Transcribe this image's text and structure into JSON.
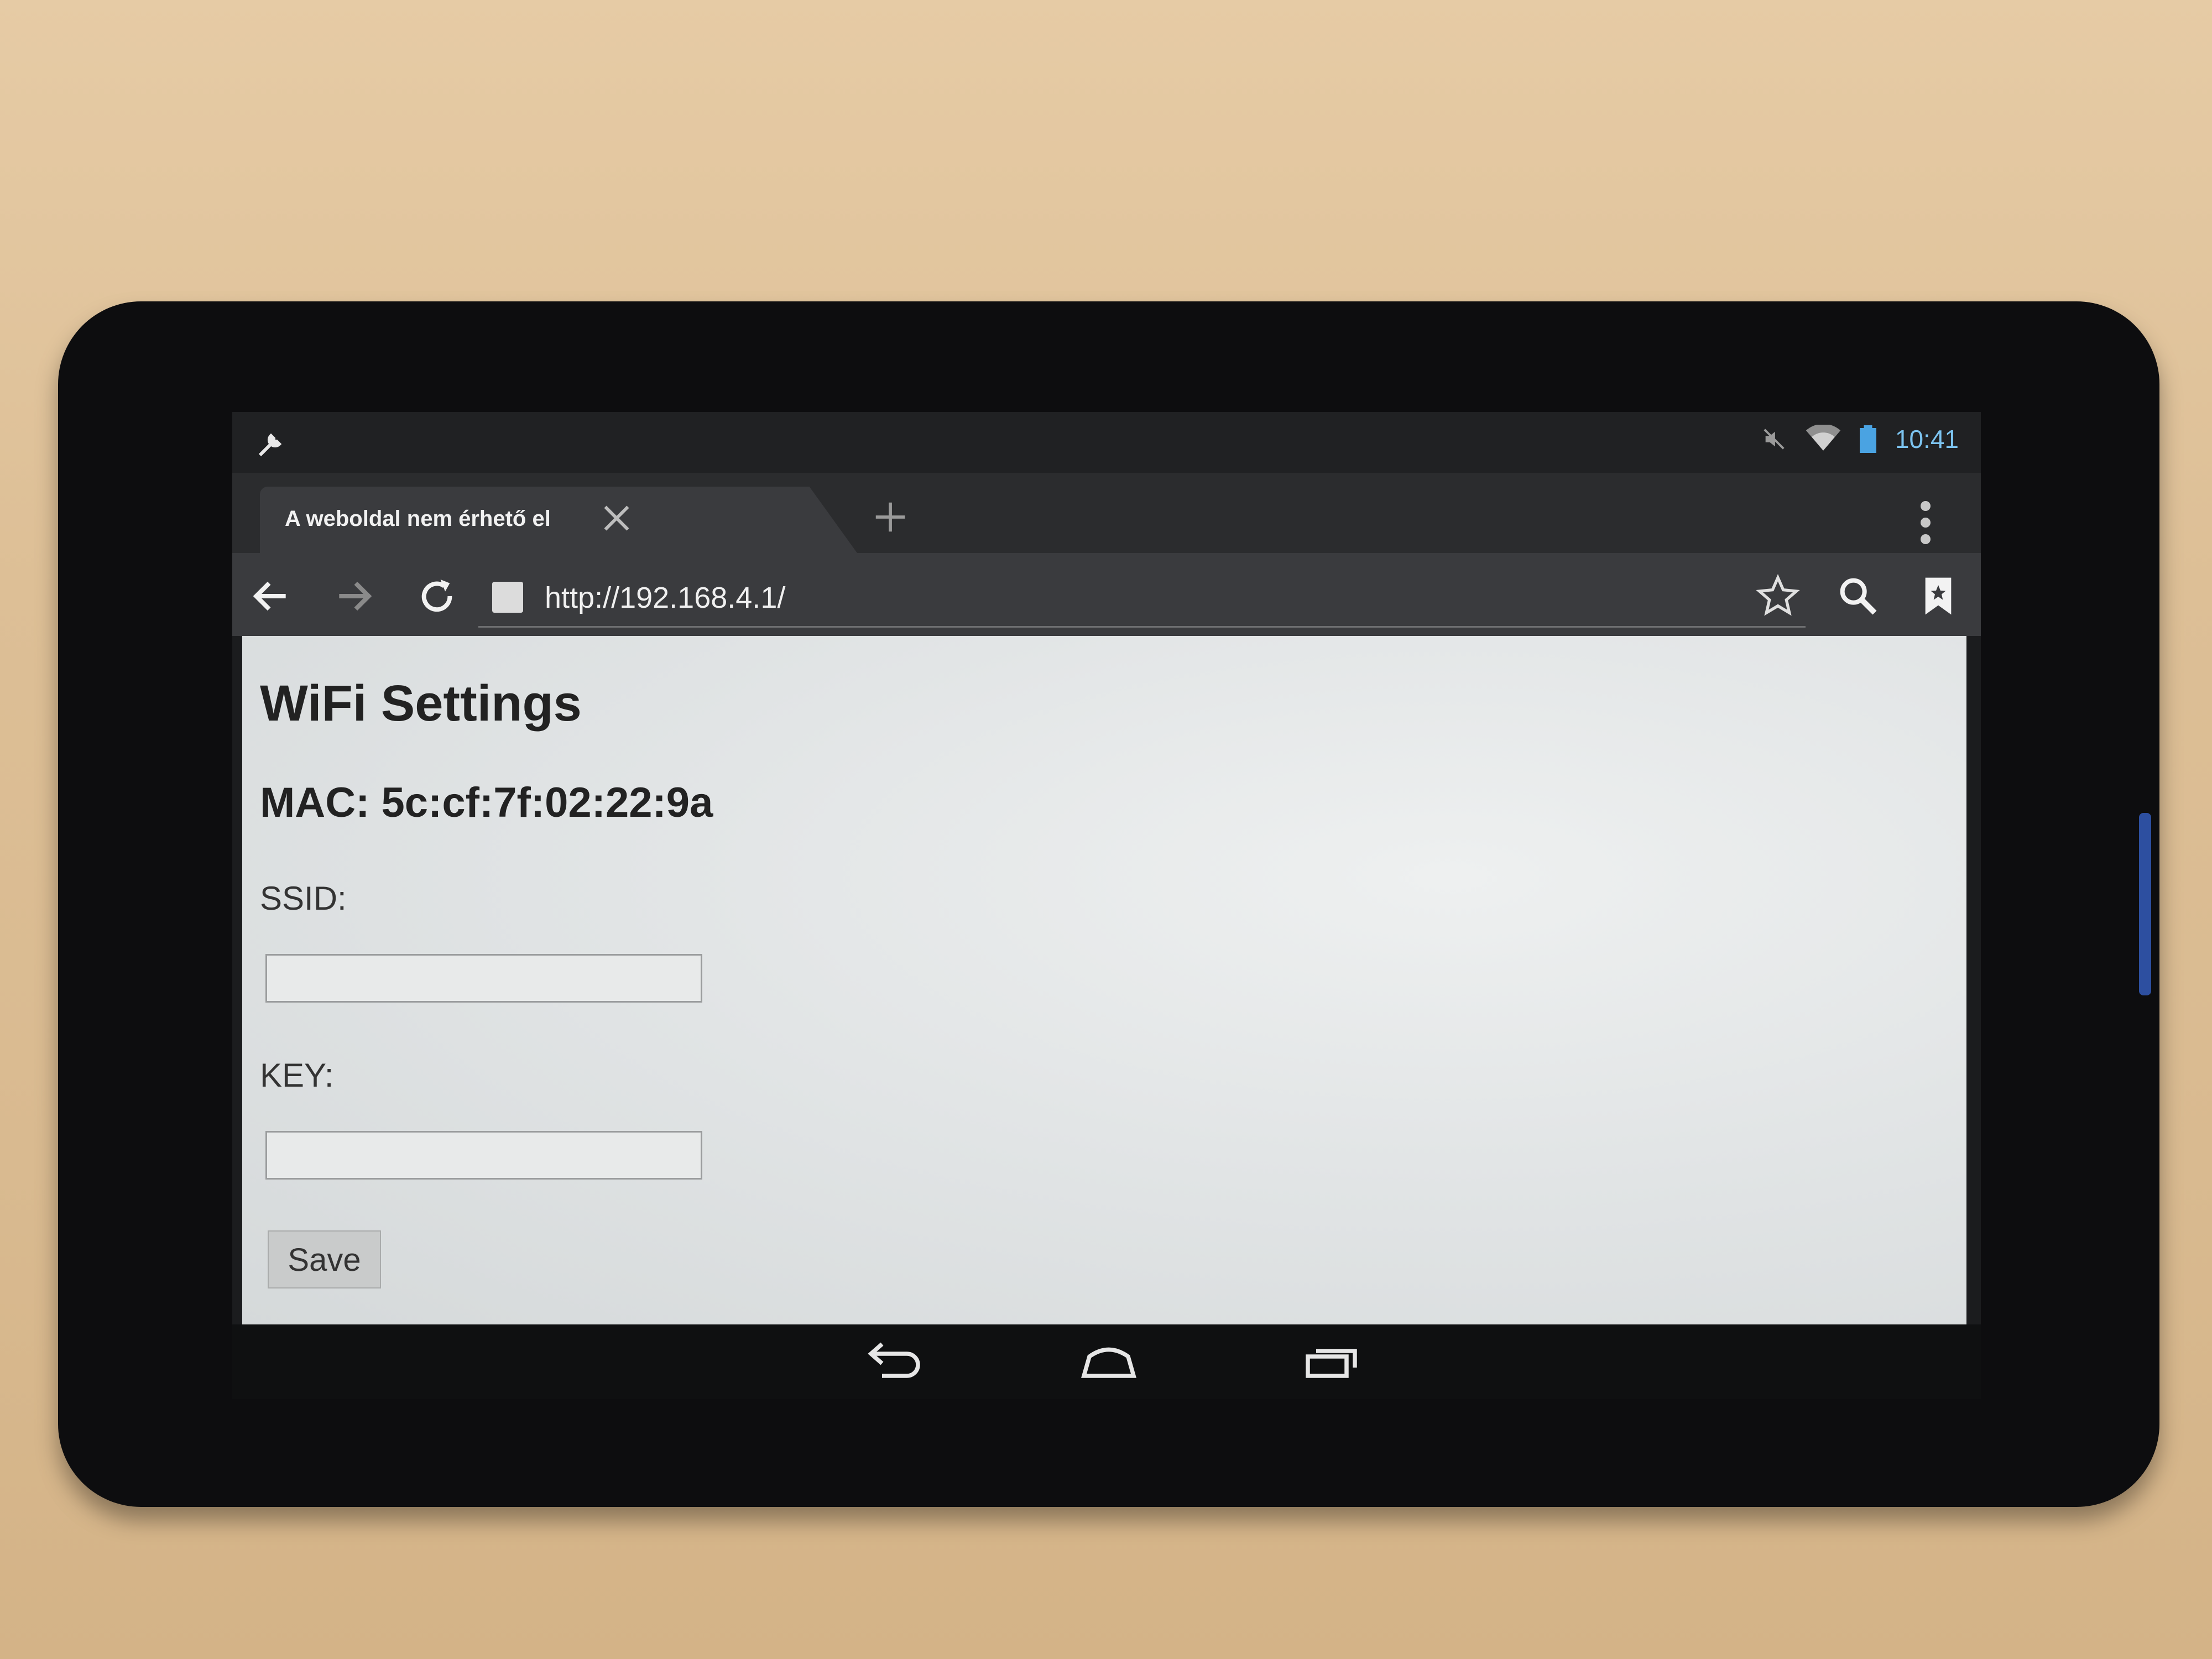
{
  "status_bar": {
    "time": "10:41",
    "icons": [
      "wrench-icon",
      "mute-icon",
      "wifi-icon",
      "battery-icon"
    ]
  },
  "browser": {
    "tab_title": "A weboldal nem érhető el",
    "url": "http://192.168.4.1/",
    "toolbar_icons": [
      "back-icon",
      "forward-icon",
      "reload-icon",
      "star-icon",
      "search-icon",
      "bookmarks-icon"
    ]
  },
  "page": {
    "heading": "WiFi Settings",
    "mac": "MAC: 5c:cf:7f:02:22:9a",
    "ssid_label": "SSID:",
    "ssid_value": "",
    "key_label": "KEY:",
    "key_value": "",
    "save_label": "Save"
  },
  "navigation_bar": [
    "back-nav-icon",
    "home-nav-icon",
    "recents-nav-icon"
  ],
  "colors": {
    "clock": "#7cc3ef",
    "page_background": "#e2e5e6",
    "tablet_bezel": "#0d0d0f",
    "button": "#c9cbcb"
  }
}
